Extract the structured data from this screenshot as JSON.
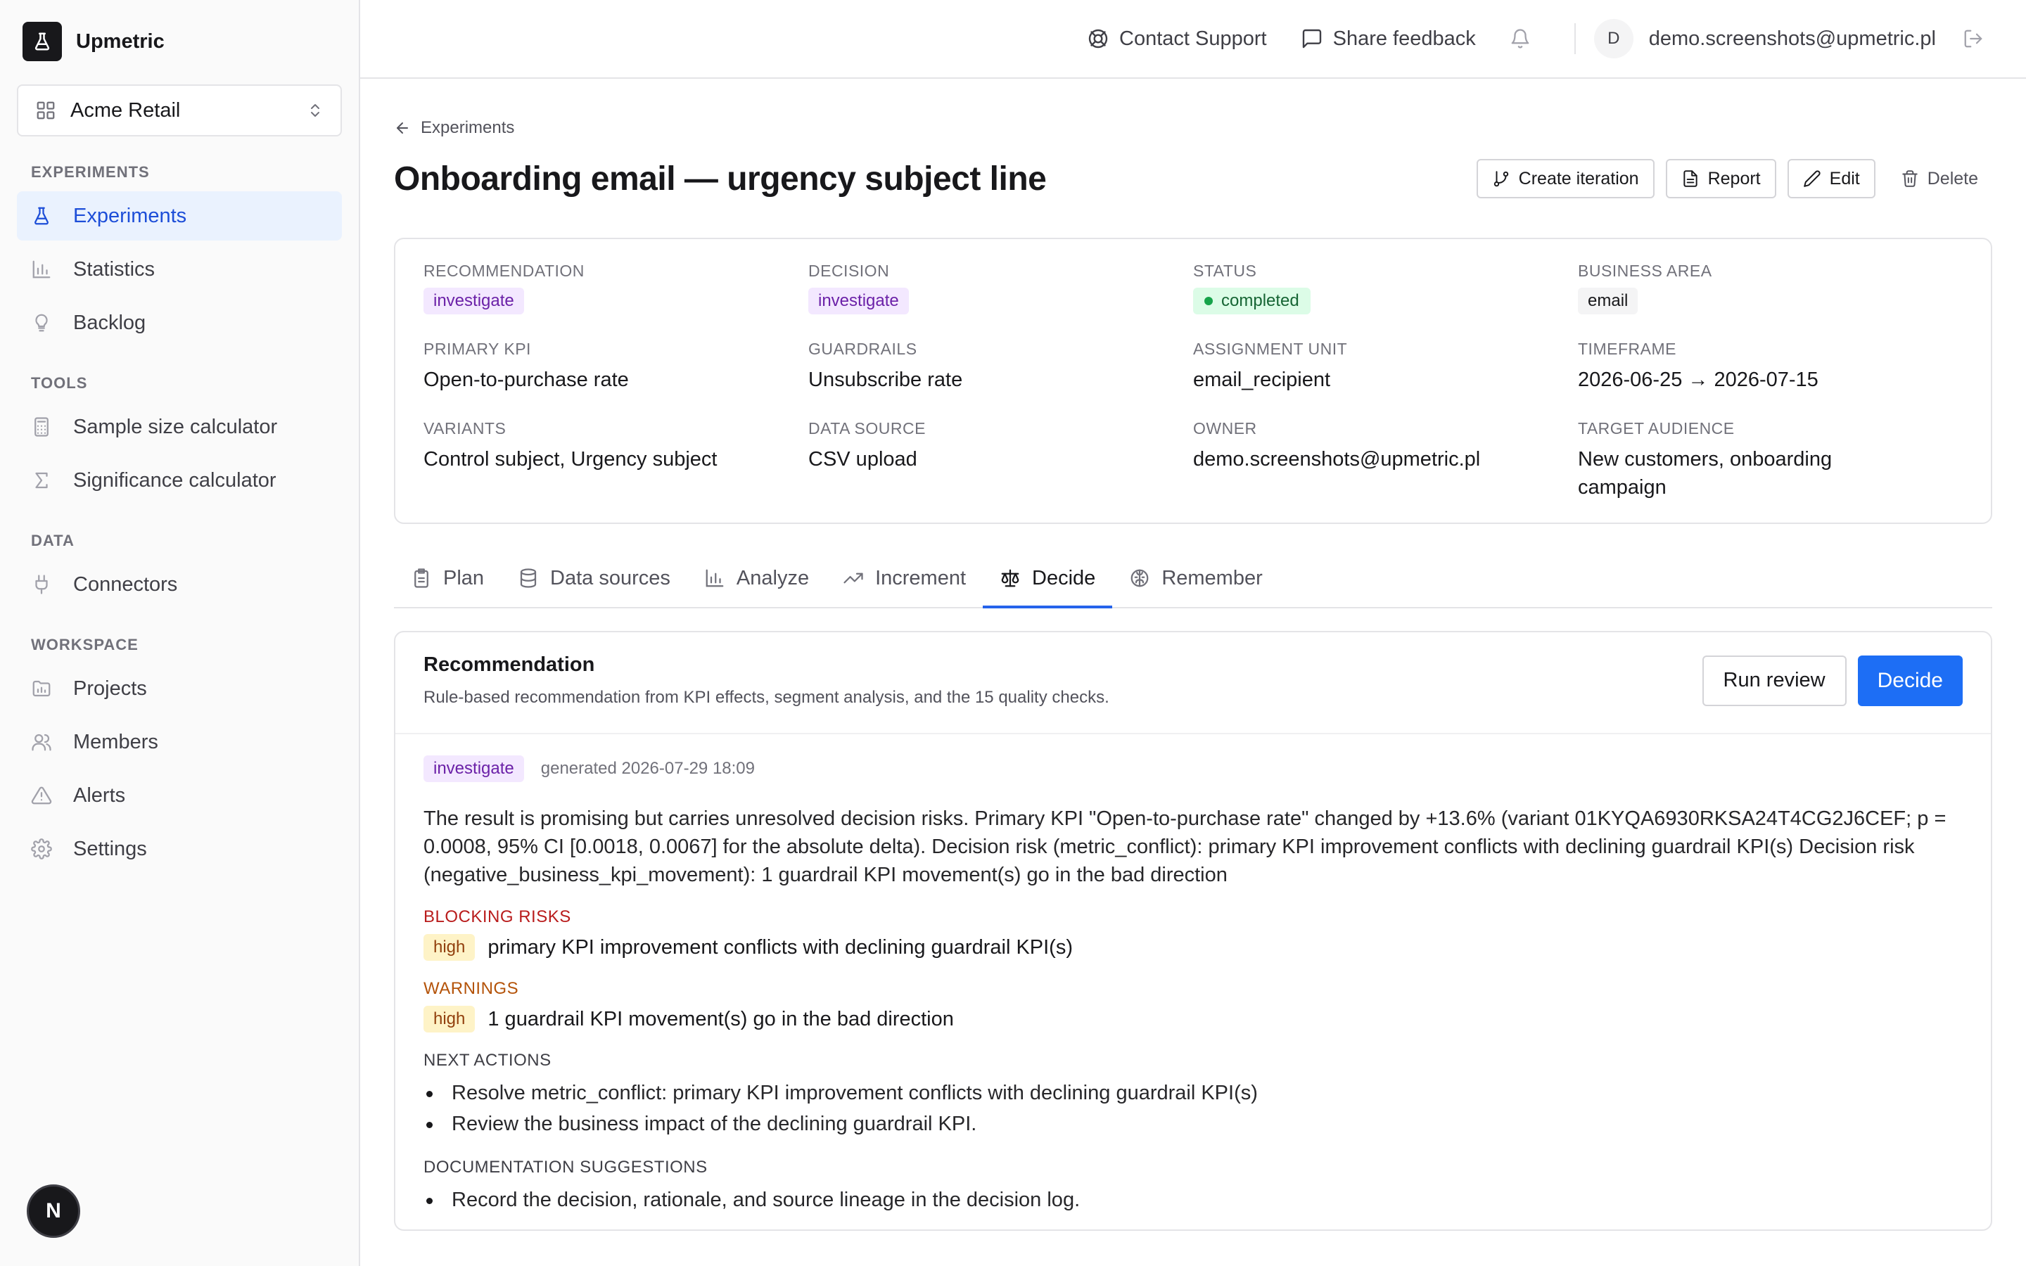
{
  "brand": {
    "name": "Upmetric",
    "logo_icon": "flask-icon"
  },
  "project_selector": {
    "label": "Acme Retail"
  },
  "sidebar": {
    "sections": [
      {
        "heading": "EXPERIMENTS",
        "items": [
          {
            "label": "Experiments",
            "icon": "flask-icon",
            "active": true
          },
          {
            "label": "Statistics",
            "icon": "bar-chart-icon"
          },
          {
            "label": "Backlog",
            "icon": "lightbulb-icon"
          }
        ]
      },
      {
        "heading": "TOOLS",
        "items": [
          {
            "label": "Sample size calculator",
            "icon": "calculator-icon"
          },
          {
            "label": "Significance calculator",
            "icon": "sigma-icon"
          }
        ]
      },
      {
        "heading": "DATA",
        "items": [
          {
            "label": "Connectors",
            "icon": "plug-icon"
          }
        ]
      },
      {
        "heading": "WORKSPACE",
        "items": [
          {
            "label": "Projects",
            "icon": "folder-icon"
          },
          {
            "label": "Members",
            "icon": "users-icon"
          },
          {
            "label": "Alerts",
            "icon": "alert-triangle-icon"
          },
          {
            "label": "Settings",
            "icon": "gear-icon"
          }
        ]
      }
    ],
    "dev_badge": "N"
  },
  "topbar": {
    "contact_support": "Contact Support",
    "share_feedback": "Share feedback",
    "avatar_initial": "D",
    "user_email": "demo.screenshots@upmetric.pl"
  },
  "breadcrumb": {
    "back_label": "Experiments"
  },
  "page": {
    "title": "Onboarding email — urgency subject line"
  },
  "actions": {
    "create_iteration": "Create iteration",
    "report": "Report",
    "edit": "Edit",
    "delete": "Delete"
  },
  "meta": {
    "recommendation": {
      "label": "RECOMMENDATION",
      "value": "investigate"
    },
    "decision": {
      "label": "DECISION",
      "value": "investigate"
    },
    "status": {
      "label": "STATUS",
      "value": "completed"
    },
    "business_area": {
      "label": "BUSINESS AREA",
      "value": "email"
    },
    "primary_kpi": {
      "label": "PRIMARY KPI",
      "value": "Open-to-purchase rate"
    },
    "guardrails": {
      "label": "GUARDRAILS",
      "value": "Unsubscribe rate"
    },
    "assignment_unit": {
      "label": "ASSIGNMENT UNIT",
      "value": "email_recipient"
    },
    "timeframe": {
      "label": "TIMEFRAME",
      "value": "2026-06-25 → 2026-07-15"
    },
    "variants": {
      "label": "VARIANTS",
      "value": "Control subject, Urgency subject"
    },
    "data_source": {
      "label": "DATA SOURCE",
      "value": "CSV upload"
    },
    "owner": {
      "label": "OWNER",
      "value": "demo.screenshots@upmetric.pl"
    },
    "target_audience": {
      "label": "TARGET AUDIENCE",
      "value": "New customers, onboarding campaign"
    }
  },
  "tabs": [
    {
      "label": "Plan",
      "icon": "clipboard-icon"
    },
    {
      "label": "Data sources",
      "icon": "database-icon"
    },
    {
      "label": "Analyze",
      "icon": "bar-chart-icon"
    },
    {
      "label": "Increment",
      "icon": "trending-up-icon"
    },
    {
      "label": "Decide",
      "icon": "scale-icon",
      "active": true
    },
    {
      "label": "Remember",
      "icon": "brain-icon"
    }
  ],
  "recommendation_card": {
    "title": "Recommendation",
    "subtitle": "Rule-based recommendation from KPI effects, segment analysis, and the 15 quality checks.",
    "run_review": "Run review",
    "decide": "Decide",
    "badge": "investigate",
    "generated": "generated 2026-07-29 18:09",
    "summary": "The result is promising but carries unresolved decision risks. Primary KPI \"Open-to-purchase rate\" changed by +13.6% (variant 01KYQA6930RKSA24T4CG2J6CEF; p = 0.0008, 95% CI [0.0018, 0.0067] for the absolute delta). Decision risk (metric_conflict): primary KPI improvement conflicts with declining guardrail KPI(s) Decision risk (negative_business_kpi_movement): 1 guardrail KPI movement(s) go in the bad direction",
    "blocking_heading": "BLOCKING RISKS",
    "blocking": [
      {
        "severity": "high",
        "text": "primary KPI improvement conflicts with declining guardrail KPI(s)"
      }
    ],
    "warnings_heading": "WARNINGS",
    "warnings": [
      {
        "severity": "high",
        "text": "1 guardrail KPI movement(s) go in the bad direction"
      }
    ],
    "next_actions_heading": "NEXT ACTIONS",
    "next_actions": [
      "Resolve metric_conflict: primary KPI improvement conflicts with declining guardrail KPI(s)",
      "Review the business impact of the declining guardrail KPI."
    ],
    "doc_heading": "DOCUMENTATION SUGGESTIONS",
    "doc_suggestions": [
      "Record the decision, rationale, and source lineage in the decision log."
    ]
  },
  "colors": {
    "accent": "#1d6ef5",
    "active_nav_bg": "#eaf2fe",
    "recommendation_pill": "#f3e8ff",
    "status_completed": "#dcfce7",
    "severity_high": "#fef3c7",
    "blocking_red": "#b91c1c",
    "warning_amber": "#b45309"
  }
}
